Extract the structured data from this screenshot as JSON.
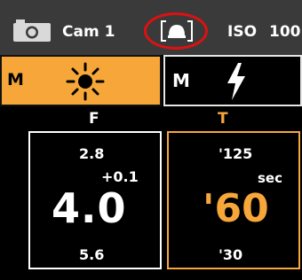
{
  "header": {
    "camera_label": "Cam 1",
    "iso_label": "ISO",
    "iso_value": "100",
    "camera_icon": "camera-icon",
    "metering_icon": "metering-mode-icon"
  },
  "modes": {
    "ambient": {
      "mode": "M",
      "icon": "sun-icon",
      "selected": true
    },
    "flash": {
      "mode": "M",
      "icon": "flash-icon",
      "selected": false
    }
  },
  "aperture": {
    "header": "F",
    "previous": "2.8",
    "compensation": "+0.1",
    "value": "4.0",
    "next": "5.6"
  },
  "shutter": {
    "header": "T",
    "previous": "'125",
    "unit": "sec",
    "value": "'60",
    "next": "'30"
  },
  "colors": {
    "accent": "#f7a73a",
    "topbar": "#3a3a3a",
    "highlight_ring": "#e01010"
  }
}
